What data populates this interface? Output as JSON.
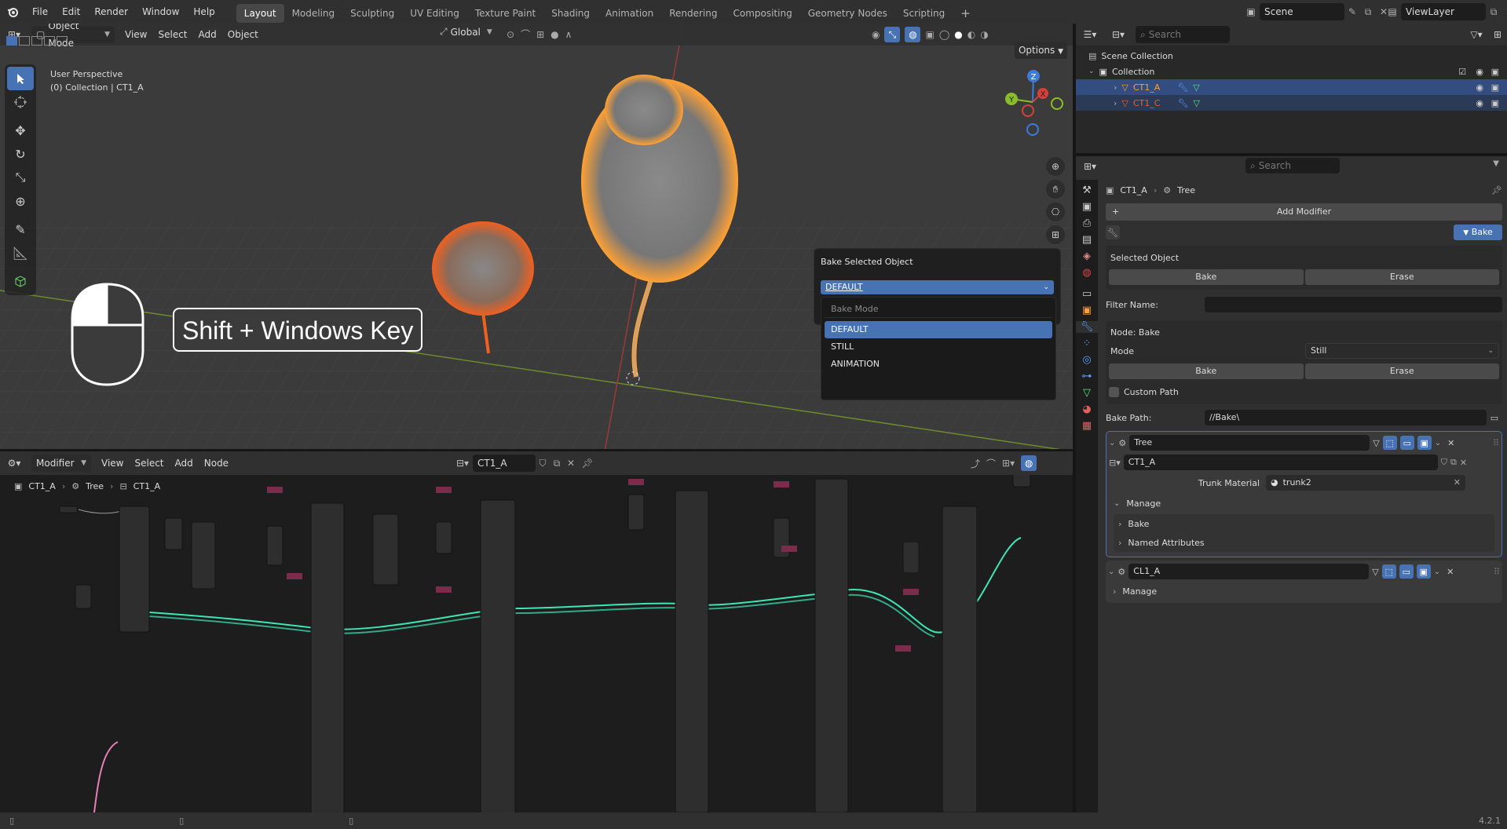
{
  "app": {
    "name": "Blender",
    "version": "4.2.1"
  },
  "menu": [
    "File",
    "Edit",
    "Render",
    "Window",
    "Help"
  ],
  "workspaces": [
    "Layout",
    "Modeling",
    "Sculpting",
    "UV Editing",
    "Texture Paint",
    "Shading",
    "Animation",
    "Rendering",
    "Compositing",
    "Geometry Nodes",
    "Scripting"
  ],
  "active_workspace": "Layout",
  "scene": {
    "name": "Scene",
    "view_layer": "ViewLayer"
  },
  "viewport": {
    "mode": "Object Mode",
    "menus": [
      "View",
      "Select",
      "Add",
      "Object"
    ],
    "transform_orientation": "Global",
    "options_label": "Options",
    "overlay_text_1": "User Perspective",
    "overlay_text_2": "(0) Collection | CT1_A",
    "shortcut_caption": "Shift + Windows Key",
    "gizmo": {
      "z": "Z",
      "y": "Y",
      "x": "X"
    }
  },
  "bake_popup": {
    "title": "Bake Selected Object",
    "selected": "DEFAULT",
    "section_label": "Bake Mode",
    "options": [
      "DEFAULT",
      "STILL",
      "ANIMATION"
    ]
  },
  "node_editor": {
    "editor_type": "Modifier",
    "menus": [
      "View",
      "Select",
      "Add",
      "Node"
    ],
    "tree_name": "CT1_A",
    "breadcrumb": [
      "CT1_A",
      "Tree",
      "CT1_A"
    ]
  },
  "outliner": {
    "search_placeholder": "Search",
    "root": "Scene Collection",
    "collection": "Collection",
    "objects": [
      "CT1_A",
      "CT1_C"
    ]
  },
  "properties": {
    "search_placeholder": "Search",
    "breadcrumb_object": "CT1_A",
    "breadcrumb_modifier": "Tree",
    "add_modifier": "Add Modifier",
    "bake_panel_label": "Bake",
    "selected_object_label": "Selected Object",
    "bake_btn": "Bake",
    "erase_btn": "Erase",
    "filter_name_label": "Filter Name:",
    "node_label": "Node:  Bake",
    "mode_label": "Mode",
    "mode_value": "Still",
    "custom_path_label": "Custom Path",
    "bake_path_label": "Bake Path:",
    "bake_path_value": "//Bake\\",
    "modifiers": [
      {
        "name": "Tree",
        "group": "CT1_A",
        "material_label": "Trunk Material",
        "material_value": "trunk2",
        "subpanels": [
          "Manage",
          "Bake",
          "Named Attributes"
        ]
      },
      {
        "name": "CL1_A",
        "subpanels": [
          "Manage"
        ]
      }
    ]
  },
  "colors": {
    "accent": "#4772b3",
    "selected_row": "#334d80",
    "orange_select": "#ffa033",
    "node_link": "#3ee6b4"
  }
}
